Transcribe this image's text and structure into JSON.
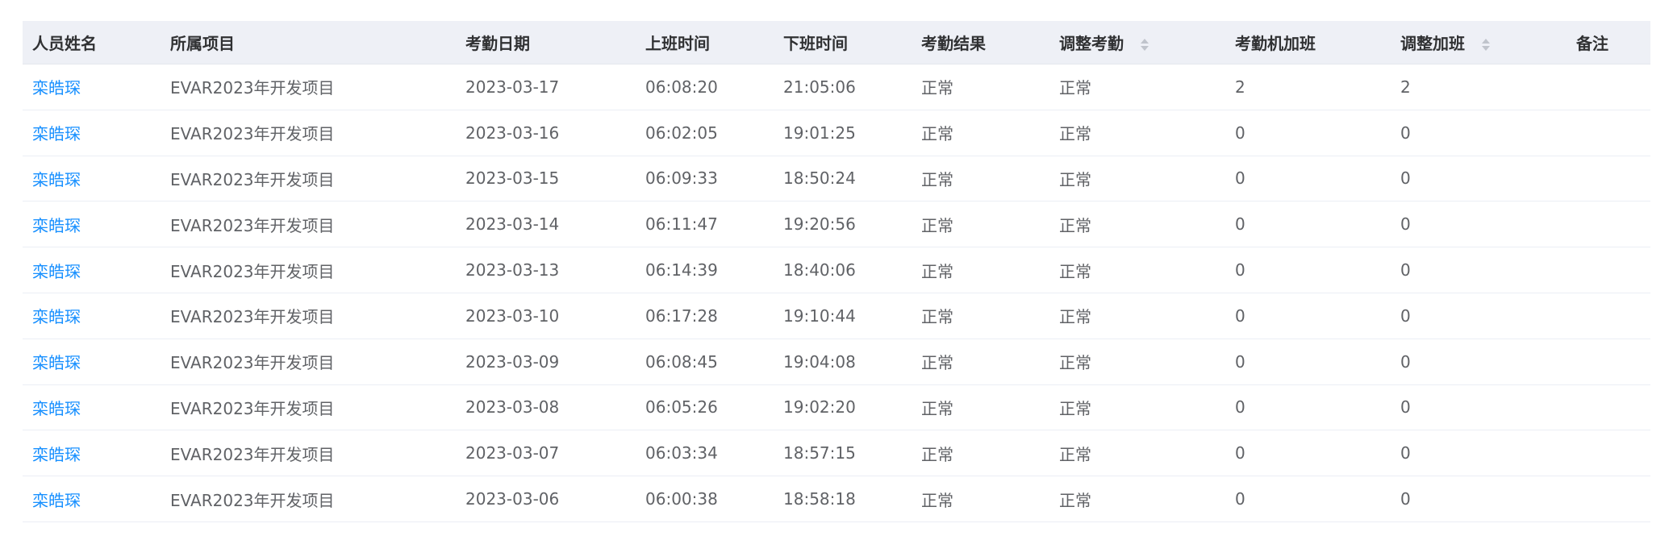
{
  "table": {
    "headers": [
      "人员姓名",
      "所属项目",
      "考勤日期",
      "上班时间",
      "下班时间",
      "考勤结果",
      "调整考勤",
      "考勤机加班",
      "调整加班",
      "备注"
    ],
    "sortable_columns": [
      6,
      8
    ],
    "colors": {
      "link": "#1890ff",
      "header_bg": "#eef0f6",
      "text": "#606266"
    },
    "rows": [
      [
        "栾皓琛",
        "EVAR2023年开发项目",
        "2023-03-17",
        "06:08:20",
        "21:05:06",
        "正常",
        "正常",
        "2",
        "2",
        ""
      ],
      [
        "栾皓琛",
        "EVAR2023年开发项目",
        "2023-03-16",
        "06:02:05",
        "19:01:25",
        "正常",
        "正常",
        "0",
        "0",
        ""
      ],
      [
        "栾皓琛",
        "EVAR2023年开发项目",
        "2023-03-15",
        "06:09:33",
        "18:50:24",
        "正常",
        "正常",
        "0",
        "0",
        ""
      ],
      [
        "栾皓琛",
        "EVAR2023年开发项目",
        "2023-03-14",
        "06:11:47",
        "19:20:56",
        "正常",
        "正常",
        "0",
        "0",
        ""
      ],
      [
        "栾皓琛",
        "EVAR2023年开发项目",
        "2023-03-13",
        "06:14:39",
        "18:40:06",
        "正常",
        "正常",
        "0",
        "0",
        ""
      ],
      [
        "栾皓琛",
        "EVAR2023年开发项目",
        "2023-03-10",
        "06:17:28",
        "19:10:44",
        "正常",
        "正常",
        "0",
        "0",
        ""
      ],
      [
        "栾皓琛",
        "EVAR2023年开发项目",
        "2023-03-09",
        "06:08:45",
        "19:04:08",
        "正常",
        "正常",
        "0",
        "0",
        ""
      ],
      [
        "栾皓琛",
        "EVAR2023年开发项目",
        "2023-03-08",
        "06:05:26",
        "19:02:20",
        "正常",
        "正常",
        "0",
        "0",
        ""
      ],
      [
        "栾皓琛",
        "EVAR2023年开发项目",
        "2023-03-07",
        "06:03:34",
        "18:57:15",
        "正常",
        "正常",
        "0",
        "0",
        ""
      ],
      [
        "栾皓琛",
        "EVAR2023年开发项目",
        "2023-03-06",
        "06:00:38",
        "18:58:18",
        "正常",
        "正常",
        "0",
        "0",
        ""
      ]
    ]
  }
}
